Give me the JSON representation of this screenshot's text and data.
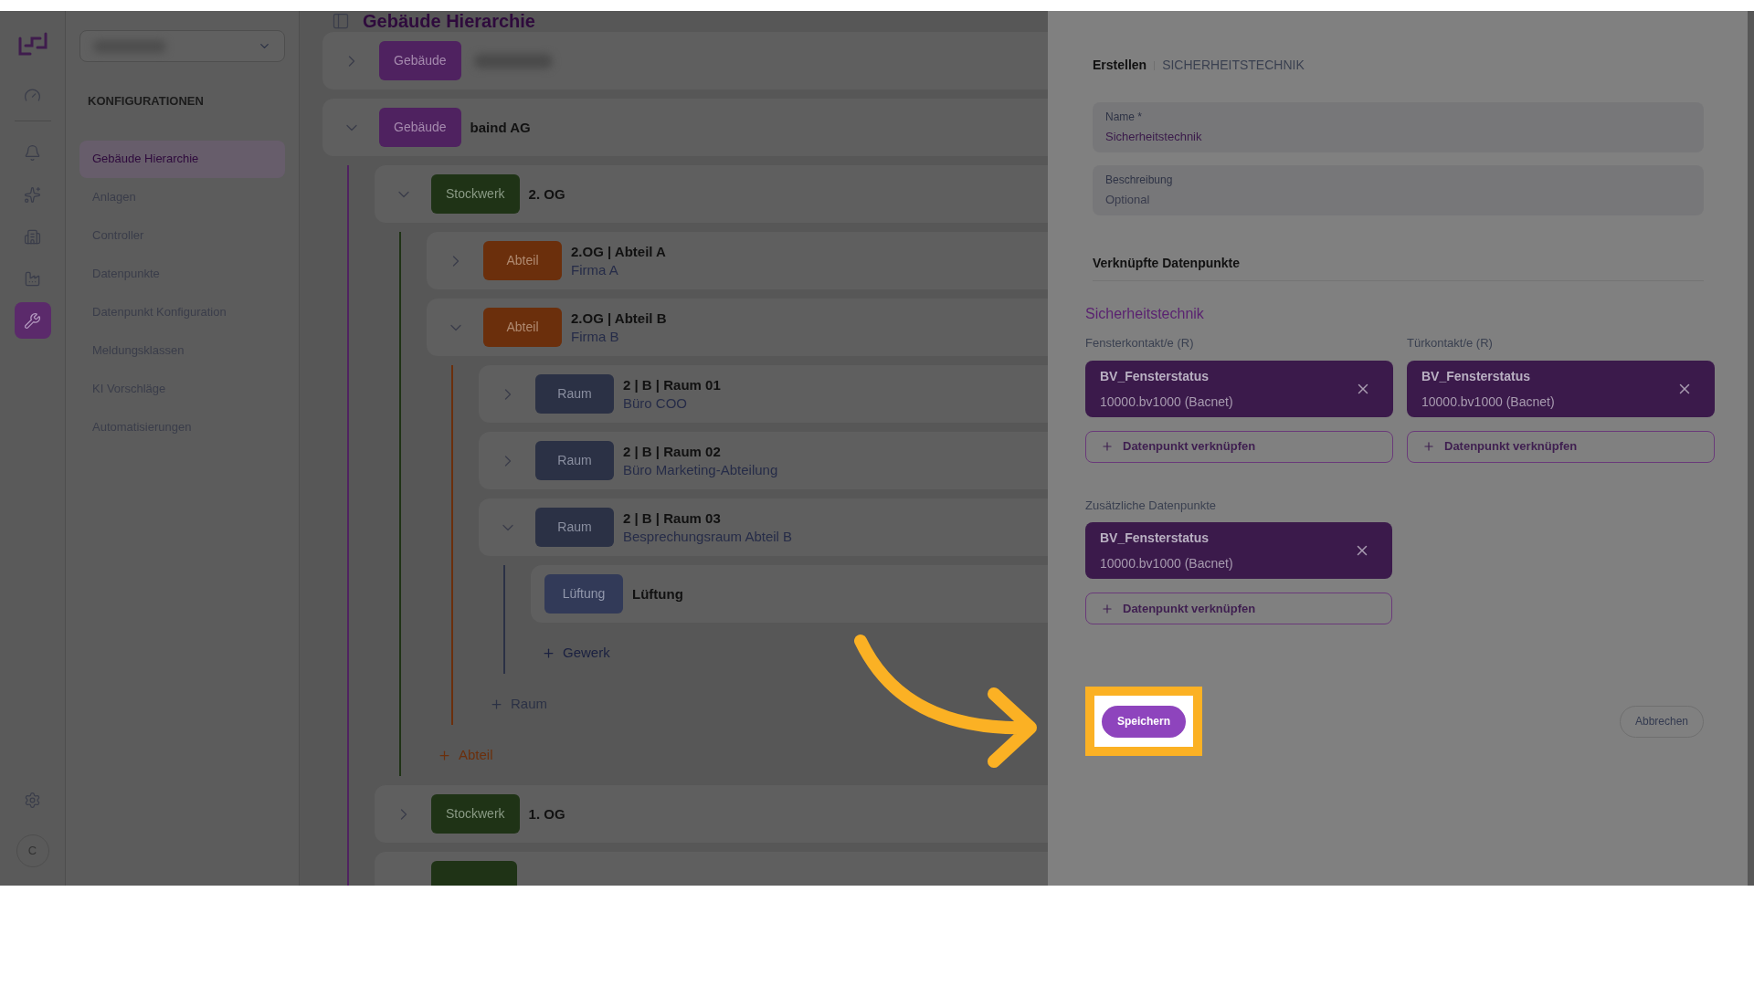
{
  "rail": {
    "items": [
      {
        "selected": false
      },
      {
        "selected": false
      },
      {
        "selected": false
      },
      {
        "selected": false
      },
      {
        "selected": false
      },
      {
        "selected": true
      }
    ],
    "avatar": "C"
  },
  "nav": {
    "selector": {
      "redacted": true
    },
    "heading": "KONFIGURATIONEN",
    "items": [
      {
        "label": "Gebäude Hierarchie",
        "selected": true
      },
      {
        "label": "Anlagen",
        "selected": false
      },
      {
        "label": "Controller",
        "selected": false
      },
      {
        "label": "Datenpunkte",
        "selected": false
      },
      {
        "label": "Datenpunkt Konfiguration",
        "selected": false
      },
      {
        "label": "Meldungsklassen",
        "selected": false
      },
      {
        "label": "KI Vorschläge",
        "selected": false
      },
      {
        "label": "Automatisierungen",
        "selected": false
      }
    ]
  },
  "page_title": "Gebäude Hierarchie",
  "tree": [
    {
      "kind": "gebaeude",
      "badge": "Gebäude",
      "redacted": true,
      "expanded": false
    },
    {
      "kind": "gebaeude",
      "badge": "Gebäude",
      "title": "baind AG",
      "expanded": true,
      "children": [
        {
          "kind": "stockwerk",
          "badge": "Stockwerk",
          "title": "2. OG",
          "expanded": true,
          "add": {
            "kind": "abteil",
            "label": "Abteil"
          },
          "children": [
            {
              "kind": "abteil",
              "badge": "Abteil",
              "title": "2.OG | Abteil A",
              "subtitle": "Firma A",
              "expanded": false
            },
            {
              "kind": "abteil",
              "badge": "Abteil",
              "title": "2.OG | Abteil B",
              "subtitle": "Firma B",
              "expanded": true,
              "add": {
                "kind": "raum",
                "label": "Raum"
              },
              "children": [
                {
                  "kind": "raum",
                  "badge": "Raum",
                  "title": "2 | B | Raum 01",
                  "subtitle": "Büro COO",
                  "expanded": false
                },
                {
                  "kind": "raum",
                  "badge": "Raum",
                  "title": "2 | B | Raum 02",
                  "subtitle": "Büro Marketing-Abteilung",
                  "expanded": false
                },
                {
                  "kind": "raum",
                  "badge": "Raum",
                  "title": "2 | B | Raum 03",
                  "subtitle": "Besprechungsraum Abteil B",
                  "expanded": true,
                  "add": {
                    "kind": "gewerk",
                    "label": "Gewerk"
                  },
                  "children": [
                    {
                      "kind": "gewerk",
                      "badge": "Lüftung",
                      "title": "Lüftung"
                    }
                  ]
                }
              ]
            }
          ]
        },
        {
          "kind": "stockwerk",
          "badge": "Stockwerk",
          "title": "1. OG",
          "expanded": false
        },
        {
          "kind": "stockwerk"
        }
      ]
    }
  ],
  "panel": {
    "breadcrumb": {
      "action": "Erstellen",
      "entity": "SICHERHEITSTECHNIK"
    },
    "fields": [
      {
        "label": "Name *",
        "value": "Sicherheitstechnik"
      },
      {
        "label": "Beschreibung",
        "placeholder": "Optional"
      }
    ],
    "linked_heading": "Verknüpfte Datenpunkte",
    "group_title": "Sicherheitstechnik",
    "slots": [
      {
        "label": "Fensterkontakt/e (R)",
        "items": [
          {
            "name": "BV_Fensterstatus",
            "address": "10000.bv1000 (Bacnet)"
          }
        ],
        "add_label": "Datenpunkt verknüpfen"
      },
      {
        "label": "Türkontakt/e (R)",
        "items": [
          {
            "name": "BV_Fensterstatus",
            "address": "10000.bv1000 (Bacnet)"
          }
        ],
        "add_label": "Datenpunkt verknüpfen"
      }
    ],
    "extra": {
      "label": "Zusätzliche Datenpunkte",
      "items": [
        {
          "name": "BV_Fensterstatus",
          "address": "10000.bv1000 (Bacnet)"
        }
      ],
      "add_label": "Datenpunkt verknüpfen"
    },
    "save": "Speichern",
    "cancel": "Abbrechen",
    "save_highlighted": true
  }
}
